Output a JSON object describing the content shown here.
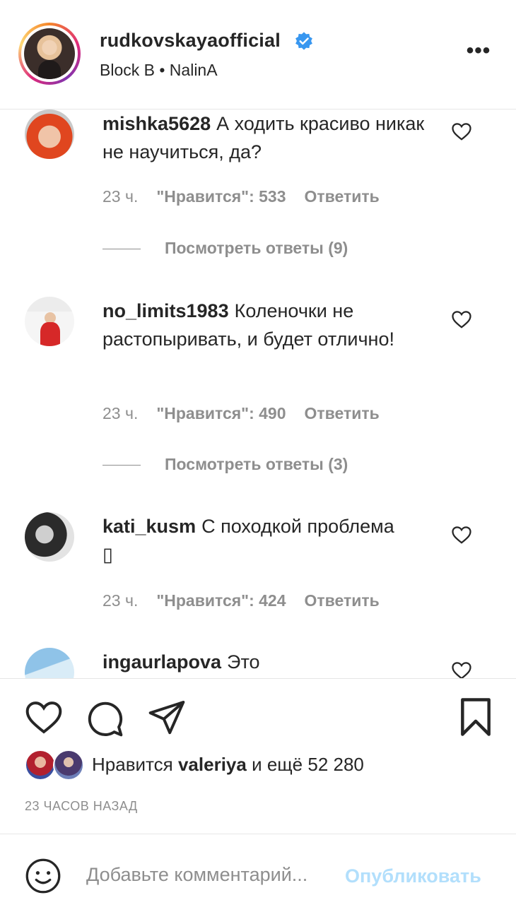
{
  "header": {
    "username": "rudkovskayaofficial",
    "verified": true,
    "location": "Block B • NalinA",
    "more_icon": "more-horizontal-icon"
  },
  "comments": [
    {
      "username": "mishka5628",
      "text": "А ходить красиво никак не научиться, да?",
      "time": "23 ч.",
      "likes": "\"Нравится\": 533",
      "reply": "Ответить",
      "view_replies": "Посмотреть ответы (9)"
    },
    {
      "username": "no_limits1983",
      "text": "Коленочки не растопыривать, и будет отлично!",
      "time": "23 ч.",
      "likes": "\"Нравится\": 490",
      "reply": "Ответить",
      "view_replies": "Посмотреть ответы (3)"
    },
    {
      "username": "kati_kusm",
      "text": "С походкой проблема",
      "text_extra": "▯",
      "time": "23 ч.",
      "likes": "\"Нравится\": 424",
      "reply": "Ответить"
    },
    {
      "username": "ingaurlapova",
      "text": "Это"
    }
  ],
  "actions": {
    "like_icon": "heart-icon",
    "comment_icon": "comment-bubble-icon",
    "share_icon": "send-icon",
    "save_icon": "bookmark-icon",
    "likes_prefix": "Нравится",
    "likes_user": "valeriya",
    "likes_suffix": "и ещё 52 280",
    "timestamp": "23 ЧАСОВ НАЗАД"
  },
  "add_comment": {
    "placeholder": "Добавьте комментарий...",
    "publish": "Опубликовать",
    "emoji_icon": "smiley-icon"
  },
  "colors": {
    "text": "#262626",
    "secondary": "#8e8e8e",
    "verified": "#3897f0",
    "publish_disabled": "#b2dffc",
    "divider": "#e6e6e6"
  }
}
